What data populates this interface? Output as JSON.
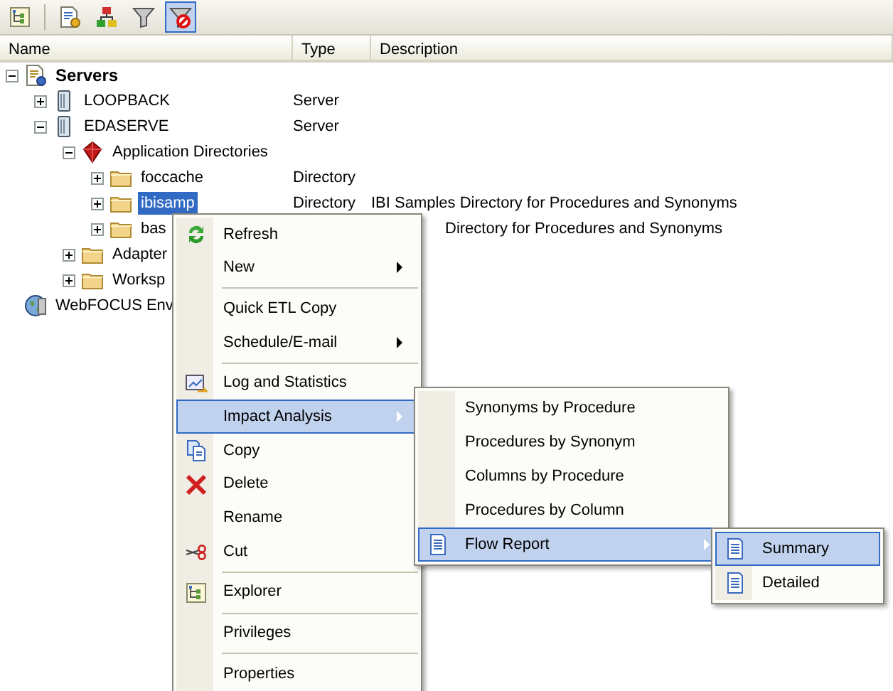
{
  "toolbar": [
    {
      "kind": "tree",
      "pressed": false
    },
    {
      "kind": "report",
      "pressed": false
    },
    {
      "kind": "hierarchy",
      "pressed": false
    },
    {
      "kind": "filter",
      "pressed": false
    },
    {
      "kind": "filter-off",
      "pressed": true
    }
  ],
  "columns": [
    "Name",
    "Type",
    "Description"
  ],
  "tree": [
    {
      "name": "Servers",
      "kind": "servers",
      "expanded": true,
      "selected": false,
      "children": [
        {
          "name": "LOOPBACK",
          "kind": "server",
          "type": "Server",
          "expanded": false,
          "selected": false
        },
        {
          "name": "EDASERVE",
          "kind": "server",
          "type": "Server",
          "expanded": true,
          "selected": false,
          "children": [
            {
              "name": "Application Directories",
              "kind": "app-dirs",
              "expanded": true,
              "selected": false,
              "children": [
                {
                  "name": "foccache",
                  "kind": "folder",
                  "type": "Directory",
                  "expanded": false,
                  "selected": false
                },
                {
                  "name": "ibisamp",
                  "kind": "folder",
                  "type": "Directory",
                  "description": "IBI Samples Directory for Procedures and Synonyms",
                  "expanded": false,
                  "selected": true
                },
                {
                  "name": "bas",
                  "kind": "folder",
                  "description": "Directory for Procedures and Synonyms",
                  "expanded": false,
                  "selected": false
                }
              ]
            },
            {
              "name": "Adapter",
              "kind": "folder",
              "expanded": false,
              "selected": false
            },
            {
              "name": "Worksp",
              "kind": "folder",
              "expanded": false,
              "selected": false
            }
          ]
        }
      ]
    },
    {
      "name": "WebFOCUS Env",
      "kind": "globe",
      "selected": false
    }
  ],
  "context_menu": [
    {
      "kind": "refresh",
      "label": "Refresh",
      "submenu": false,
      "highlighted": false
    },
    {
      "kind": "plain",
      "label": "New",
      "submenu": true,
      "highlighted": false
    },
    {
      "kind": "separator"
    },
    {
      "kind": "plain",
      "label": "Quick ETL Copy",
      "submenu": false,
      "highlighted": false
    },
    {
      "kind": "plain",
      "label": "Schedule/E-mail",
      "submenu": true,
      "highlighted": false
    },
    {
      "kind": "separator"
    },
    {
      "kind": "log",
      "label": "Log and Statistics",
      "submenu": false,
      "highlighted": false
    },
    {
      "kind": "plain",
      "label": "Impact Analysis",
      "submenu": true,
      "highlighted": true
    },
    {
      "kind": "copy",
      "label": "Copy",
      "submenu": false,
      "highlighted": false
    },
    {
      "kind": "delete",
      "label": "Delete",
      "submenu": false,
      "highlighted": false
    },
    {
      "kind": "plain",
      "label": "Rename",
      "submenu": false,
      "highlighted": false
    },
    {
      "kind": "cut",
      "label": "Cut",
      "submenu": false,
      "highlighted": false
    },
    {
      "kind": "separator"
    },
    {
      "kind": "tree",
      "label": "Explorer",
      "submenu": false,
      "highlighted": false
    },
    {
      "kind": "separator"
    },
    {
      "kind": "plain",
      "label": "Privileges",
      "submenu": false,
      "highlighted": false
    },
    {
      "kind": "separator"
    },
    {
      "kind": "plain",
      "label": "Properties",
      "submenu": false,
      "highlighted": false
    }
  ],
  "impact_submenu": [
    {
      "kind": "plain",
      "label": "Synonyms by Procedure",
      "submenu": false,
      "highlighted": false
    },
    {
      "kind": "plain",
      "label": "Procedures by Synonym",
      "submenu": false,
      "highlighted": false
    },
    {
      "kind": "plain",
      "label": "Columns by Procedure",
      "submenu": false,
      "highlighted": false
    },
    {
      "kind": "plain",
      "label": "Procedures by Column",
      "submenu": false,
      "highlighted": false
    },
    {
      "kind": "report-doc",
      "label": "Flow Report",
      "submenu": true,
      "highlighted": true
    }
  ],
  "flow_submenu": [
    {
      "kind": "report-doc",
      "label": "Summary",
      "submenu": false,
      "highlighted": true
    },
    {
      "kind": "report-doc",
      "label": "Detailed",
      "submenu": false,
      "highlighted": false
    }
  ]
}
